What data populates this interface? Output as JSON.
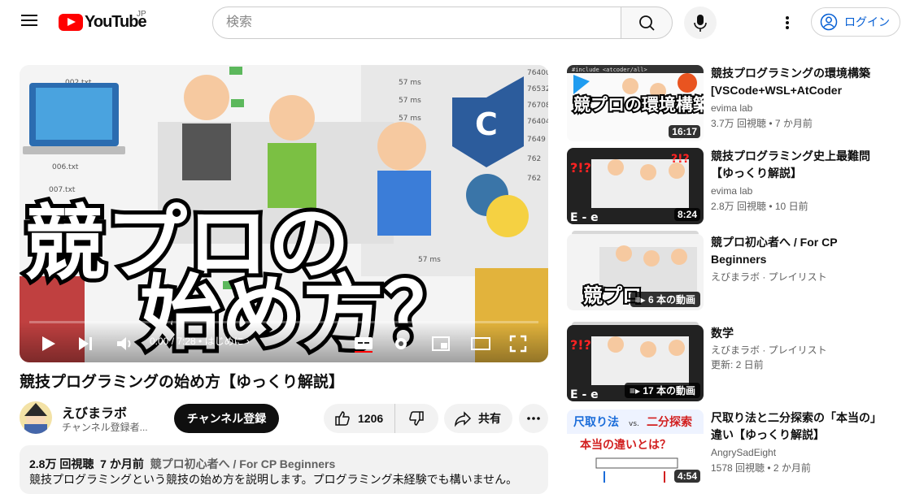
{
  "header": {
    "logo_text": "YouTube",
    "logo_country": "JP",
    "search_placeholder": "検索",
    "login_label": "ログイン"
  },
  "player": {
    "time": "0:00 / 7:28 • はじめに ›",
    "overlay_line1": "競プロの",
    "overlay_line2": "始め方？"
  },
  "video": {
    "title": "競技プログラミングの始め方【ゆっくり解説】",
    "channel_name": "えびまラボ",
    "channel_subs": "チャンネル登録者...",
    "subscribe_label": "チャンネル登録",
    "like_count": "1206",
    "share_label": "共有",
    "views": "2.8万 回視聴",
    "age": "7 か月前",
    "playlist": "競プロ初心者へ / For CP Beginners",
    "description": "競技プログラミングという競技の始め方を説明します。プログラミング未経験でも構いません。"
  },
  "sidebar": [
    {
      "title": "競技プログラミングの環境構築 [VSCode+WSL+AtCoder Librar...",
      "channel": "evima lab",
      "meta": "3.7万 回視聴 • 7 か月前",
      "badge": "16:17",
      "thumb_text": "競プロの環境構築？",
      "thumb_code": "#include <atcoder/all>"
    },
    {
      "title": "競技プログラミング史上最難問【ゆっくり解説】",
      "channel": "evima lab",
      "meta": "2.8万 回視聴 • 10 日前",
      "badge": "8:24",
      "thumb_text": "E - e"
    },
    {
      "title": "競プロ初心者へ / For CP Beginners",
      "channel": "えびまラボ · プレイリスト",
      "meta": "",
      "badge": "6 本の動画",
      "thumb_text": "競プロ"
    },
    {
      "title": "数学",
      "channel": "えびまラボ · プレイリスト",
      "meta": "更新: 2 日前",
      "badge": "17 本の動画",
      "thumb_text": "E - e"
    },
    {
      "title": "尺取り法と二分探索の「本当の」違い【ゆっくり解説】",
      "channel": "AngrySadEight",
      "meta": "1578 回視聴 • 2 か月前",
      "badge": "4:54",
      "thumb_text1": "尺取り法",
      "thumb_vs": "vs.",
      "thumb_text2": "二分探索",
      "thumb_text3": "本当の違いとは？"
    }
  ]
}
